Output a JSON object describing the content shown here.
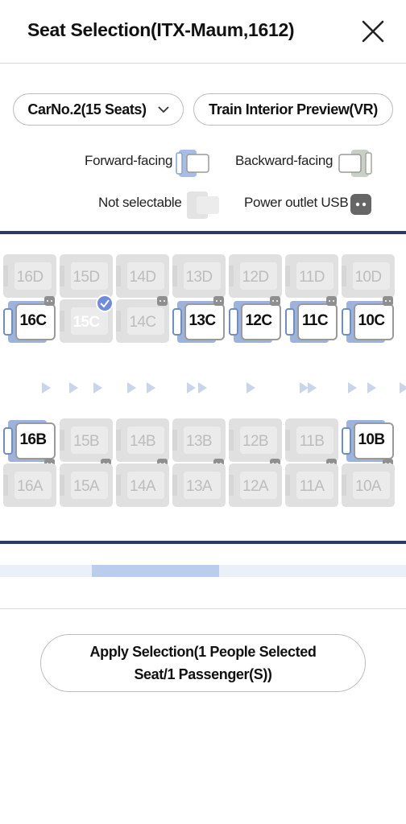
{
  "header": {
    "title": "Seat Selection(ITX-Maum,1612)"
  },
  "controls": {
    "car_label": "CarNo.2(15 Seats)",
    "vr_label": "Train Interior Preview(VR)"
  },
  "legend": {
    "forward": "Forward-facing",
    "backward": "Backward-facing",
    "not_selectable": "Not selectable",
    "usb": "Power outlet USB"
  },
  "seats": {
    "rowD": [
      "16D",
      "15D",
      "14D",
      "13D",
      "12D",
      "11D",
      "10D"
    ],
    "rowC": [
      "16C",
      "15C",
      "14C",
      "13C",
      "12C",
      "11C",
      "10C"
    ],
    "rowB": [
      "16B",
      "15B",
      "14B",
      "13B",
      "12B",
      "11B",
      "10B"
    ],
    "rowA": [
      "16A",
      "15A",
      "14A",
      "13A",
      "12A",
      "11A",
      "10A"
    ],
    "selected": "15C"
  },
  "footer": {
    "apply_label": "Apply Selection(1 People Selected Seat/1 Passenger(S))"
  },
  "colors": {
    "seat_blue": "#9db3db",
    "selected_blue": "#3f57c9",
    "disabled_gray": "#e0e0e0",
    "rule_navy": "#2b3a67"
  }
}
